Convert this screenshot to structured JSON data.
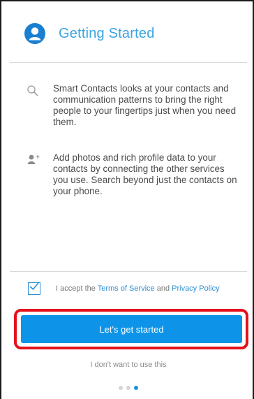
{
  "header": {
    "title": "Getting Started",
    "icon": "profile-icon",
    "accent_color": "#3aa3e3"
  },
  "features": [
    {
      "icon": "search-icon",
      "text": "Smart Contacts looks at your contacts and communication patterns to bring the right people to your fingertips just when you need them."
    },
    {
      "icon": "add-person-icon",
      "text": "Add photos and rich profile data to your contacts by connecting the other services you use. Search beyond just the contacts on your phone."
    }
  ],
  "accept": {
    "checked": true,
    "prefix": "I accept the ",
    "terms_link": "Terms of Service",
    "middle": " and ",
    "privacy_link": "Privacy Policy"
  },
  "cta": {
    "label": "Let's get started",
    "color": "#0d94e8",
    "highlight_color": "#e4121c"
  },
  "decline": {
    "label": "I don't want to use this"
  },
  "pagination": {
    "total": 3,
    "current": 3
  }
}
